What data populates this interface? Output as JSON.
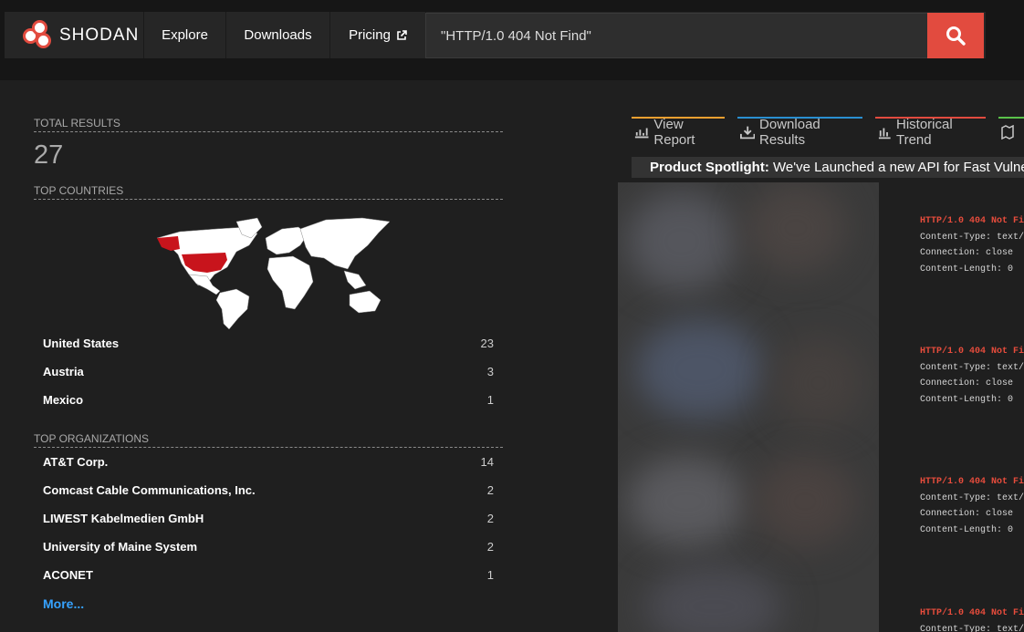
{
  "header": {
    "brand": "SHODAN",
    "nav": [
      "Explore",
      "Downloads",
      "Pricing"
    ],
    "search_value": "\"HTTP/1.0 404 Not Find\"",
    "accent": "#e24b3f"
  },
  "summary": {
    "total_label": "TOTAL RESULTS",
    "total": "27",
    "countries_label": "TOP COUNTRIES",
    "countries": [
      {
        "name": "United States",
        "count": "23"
      },
      {
        "name": "Austria",
        "count": "3"
      },
      {
        "name": "Mexico",
        "count": "1"
      }
    ],
    "orgs_label": "TOP ORGANIZATIONS",
    "orgs": [
      {
        "name": "AT&T Corp.",
        "count": "14"
      },
      {
        "name": "Comcast Cable Communications, Inc.",
        "count": "2"
      },
      {
        "name": "LIWEST Kabelmedien GmbH",
        "count": "2"
      },
      {
        "name": "University of Maine System",
        "count": "2"
      },
      {
        "name": "ACONET",
        "count": "1"
      }
    ],
    "more": "More..."
  },
  "tabs": {
    "view_report": "View Report",
    "download_results": "Download Results",
    "historical_trend": "Historical Trend"
  },
  "spotlight": {
    "label": "Product Spotlight:",
    "text": " We've Launched a new API for Fast Vulnera"
  },
  "results": [
    {
      "status": "HTTP/1.0 404 Not Fi",
      "l1": "Content-Type: text/",
      "l2": "Connection: close",
      "l3": "Content-Length: 0"
    },
    {
      "status": "HTTP/1.0 404 Not Fi",
      "l1": "Content-Type: text/",
      "l2": "Connection: close",
      "l3": "Content-Length: 0"
    },
    {
      "status": "HTTP/1.0 404 Not Fi",
      "l1": "Content-Type: text/",
      "l2": "Connection: close",
      "l3": "Content-Length: 0"
    },
    {
      "status": "HTTP/1.0 404 Not Fi",
      "l1": "Content-Type: text/"
    }
  ]
}
